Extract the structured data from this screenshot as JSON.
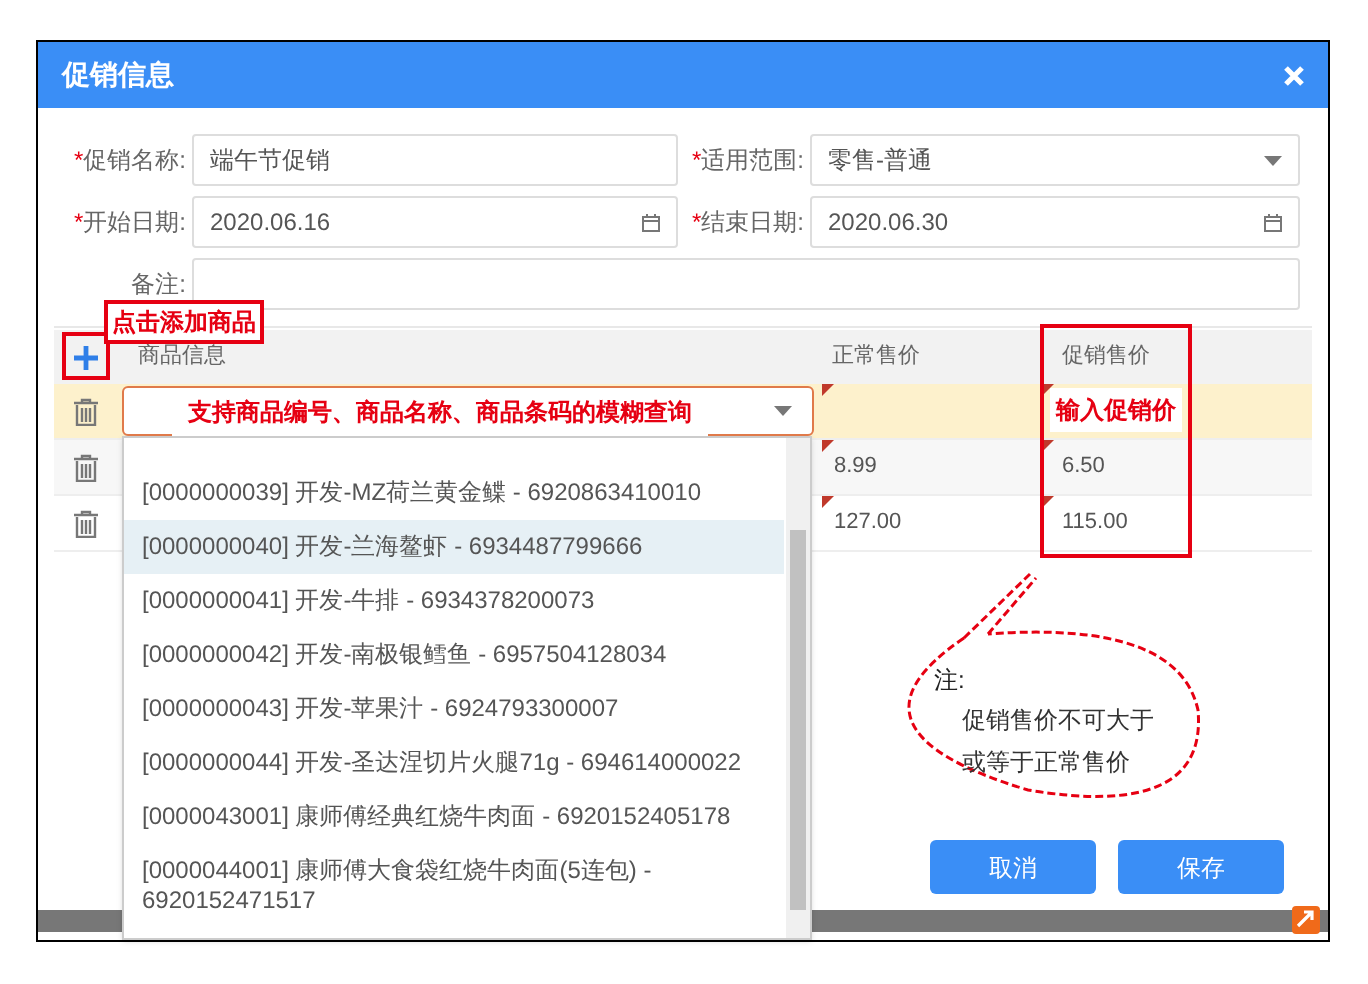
{
  "dialog": {
    "title": "促销信息"
  },
  "form": {
    "fields": [
      {
        "kind": "text",
        "required_mark": "*",
        "label": "促销名称:",
        "value": "端午节促销"
      },
      {
        "kind": "select",
        "required_mark": "*",
        "label": "适用范围:",
        "value": "零售-普通"
      },
      {
        "kind": "date",
        "required_mark": "*",
        "label": "开始日期:",
        "value": "2020.06.16"
      },
      {
        "kind": "date",
        "required_mark": "*",
        "label": "结束日期:",
        "value": "2020.06.30"
      },
      {
        "kind": "wide",
        "label": "备注:"
      }
    ]
  },
  "table": {
    "columns": [
      "商品信息",
      "正常售价",
      "促销售价"
    ],
    "rows": [
      {
        "selected": true,
        "edited": true
      },
      {
        "selected": false,
        "edited": true,
        "normal_price": "8.99",
        "promo_price": "6.50"
      },
      {
        "selected": false,
        "edited": true,
        "normal_price": "127.00",
        "promo_price": "115.00"
      }
    ]
  },
  "product_dropdown": {
    "options": [
      {
        "label": "[0000000039] 开发-MZ荷兰黄金鲽 - 6920863410010",
        "selected": false
      },
      {
        "label": "[0000000040] 开发-兰海鳌虾 - 6934487799666",
        "selected": true
      },
      {
        "label": "[0000000041] 开发-牛排 - 6934378200073",
        "selected": false
      },
      {
        "label": "[0000000042] 开发-南极银鳕鱼 - 6957504128034",
        "selected": false
      },
      {
        "label": "[0000000043] 开发-苹果汁 - 6924793300007",
        "selected": false
      },
      {
        "label": "[0000000044] 开发-圣达涅切片火腿71g - 694614000022",
        "selected": false
      },
      {
        "label": "[0000043001] 康师傅经典红烧牛肉面 - 6920152405178",
        "selected": false
      },
      {
        "label": "[0000044001] 康师傅大食袋红烧牛肉面(5连包) - 6920152471517",
        "selected": false
      }
    ]
  },
  "buttons": [
    "取消",
    "保存"
  ],
  "annotations": {
    "add_hint": "点击添加商品",
    "search_hint": "支持商品编号、商品名称、商品条码的模糊查询",
    "price_hint": "输入促销价",
    "note": {
      "title": "注:",
      "lines": [
        "促销售价不可大于",
        "或等于正常售价"
      ]
    }
  }
}
